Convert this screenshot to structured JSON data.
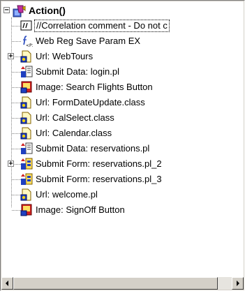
{
  "tree": {
    "root": {
      "label": "Action()",
      "icon": "action-script-icon",
      "expanded": true
    },
    "items": [
      {
        "label": "//Correlation comment - Do not c",
        "icon": "comment-icon",
        "expandable": false,
        "selected": true
      },
      {
        "label": "Web Reg Save Param EX",
        "icon": "save-param-function-icon",
        "expandable": false
      },
      {
        "label": "Url: WebTours",
        "icon": "url-step-icon",
        "expandable": true
      },
      {
        "label": "Submit Data: login.pl",
        "icon": "submit-data-icon",
        "expandable": false
      },
      {
        "label": "Image: Search Flights Button",
        "icon": "image-step-icon",
        "expandable": false
      },
      {
        "label": "Url: FormDateUpdate.class",
        "icon": "url-step-icon",
        "expandable": false
      },
      {
        "label": "Url: CalSelect.class",
        "icon": "url-step-icon",
        "expandable": false
      },
      {
        "label": "Url: Calendar.class",
        "icon": "url-step-icon",
        "expandable": false
      },
      {
        "label": "Submit Data: reservations.pl",
        "icon": "submit-data-icon",
        "expandable": false
      },
      {
        "label": "Submit Form: reservations.pl_2",
        "icon": "submit-form-icon",
        "expandable": true
      },
      {
        "label": "Submit Form: reservations.pl_3",
        "icon": "submit-form-icon",
        "expandable": false
      },
      {
        "label": "Url: welcome.pl",
        "icon": "url-step-icon",
        "expandable": false
      },
      {
        "label": "Image: SignOff Button",
        "icon": "image-step-icon",
        "expandable": false
      }
    ]
  },
  "scrollbar": {
    "left_icon": "scroll-left-arrow-icon",
    "right_icon": "scroll-right-arrow-icon"
  }
}
